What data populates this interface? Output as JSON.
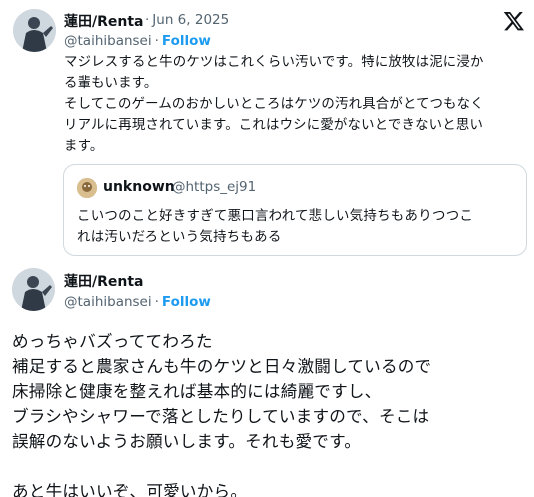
{
  "tweet1": {
    "name": "蓮田/Renta",
    "date": "Jun 6, 2025",
    "handle": "@taihibansei",
    "follow": "Follow",
    "lines": [
      "マジレスすると牛のケツはこれくらい汚いです。特に放牧は泥に浸か",
      "る輩もいます。",
      "そしてこのゲームのおかしいところはケツの汚れ具合がとてつもなく",
      "リアルに再現されています。これはウシに愛がないとできないと思い",
      "ます。"
    ]
  },
  "quote": {
    "name": "unknown",
    "handle": "@https_ej91",
    "lines": [
      "こいつのこと好きすぎて悪口言われて悲しい気持ちもありつつこ",
      "れは汚いだろという気持ちもある"
    ]
  },
  "tweet2": {
    "name": "蓮田/Renta",
    "handle": "@taihibansei",
    "follow": "Follow",
    "lines": [
      "めっちゃバズっててわろた",
      "補足すると農家さんも牛のケツと日々激闘しているので",
      "床掃除と健康を整えれば基本的には綺麗ですし、",
      "ブラシやシャワーで落としたりしていますので、そこは",
      "誤解のないようお願いします。それも愛です。",
      "",
      "あと牛はいいぞ、可愛いから。"
    ]
  },
  "icons": {
    "x_logo": "x-logo-icon",
    "avatar": "avatar-photo",
    "quote_avatar": "quote-avatar-photo"
  },
  "colors": {
    "link": "#1d9bf0",
    "secondary_text": "#536471",
    "border": "#cfd9de"
  }
}
